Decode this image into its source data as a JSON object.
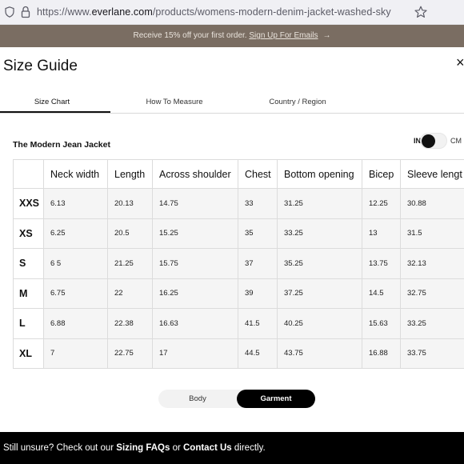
{
  "browser": {
    "url_prefix": "https://www.",
    "url_domain": "everlane.com",
    "url_path": "/products/womens-modern-denim-jacket-washed-sky",
    "icons": [
      "shield-icon",
      "lock-icon",
      "star-icon"
    ]
  },
  "promo": {
    "text": "Receive 15% off your first order. ",
    "link": "Sign Up For Emails",
    "arrow": "→",
    "colors": {
      "background": "#7a6d62",
      "text": "#e9e3dc"
    }
  },
  "modal": {
    "title": "Size Guide",
    "close": "×"
  },
  "tabs": [
    {
      "label": "Size Chart",
      "active": true
    },
    {
      "label": "How To Measure",
      "active": false
    },
    {
      "label": "Country / Region",
      "active": false
    }
  ],
  "product": {
    "name": "The Modern Jean Jacket",
    "unit_left": "IN",
    "unit_right": "CM",
    "selected_unit": "IN"
  },
  "size_table": {
    "headers": [
      "Neck width",
      "Length",
      "Across shoulder",
      "Chest",
      "Bottom opening",
      "Bicep",
      "Sleeve lengt"
    ],
    "rows": [
      {
        "size": "XXS",
        "values": [
          "6.13",
          "20.13",
          "14.75",
          "33",
          "31.25",
          "12.25",
          "30.88"
        ]
      },
      {
        "size": "XS",
        "values": [
          "6.25",
          "20.5",
          "15.25",
          "35",
          "33.25",
          "13",
          "31.5"
        ]
      },
      {
        "size": "S",
        "values": [
          "6 5",
          "21.25",
          "15.75",
          "37",
          "35.25",
          "13.75",
          "32.13"
        ]
      },
      {
        "size": "M",
        "values": [
          "6.75",
          "22",
          "16.25",
          "39",
          "37.25",
          "14.5",
          "32.75"
        ]
      },
      {
        "size": "L",
        "values": [
          "6.88",
          "22.38",
          "16.63",
          "41.5",
          "40.25",
          "15.63",
          "33.25"
        ]
      },
      {
        "size": "XL",
        "values": [
          "7",
          "22.75",
          "17",
          "44.5",
          "43.75",
          "16.88",
          "33.75"
        ]
      }
    ]
  },
  "measure_type": {
    "options": [
      "Body",
      "Garment"
    ],
    "selected": "Garment"
  },
  "footer": {
    "text1": "Still unsure? Check out our ",
    "link1": "Sizing FAQs",
    "text2": " or ",
    "link2": "Contact Us",
    "text3": " directly."
  }
}
